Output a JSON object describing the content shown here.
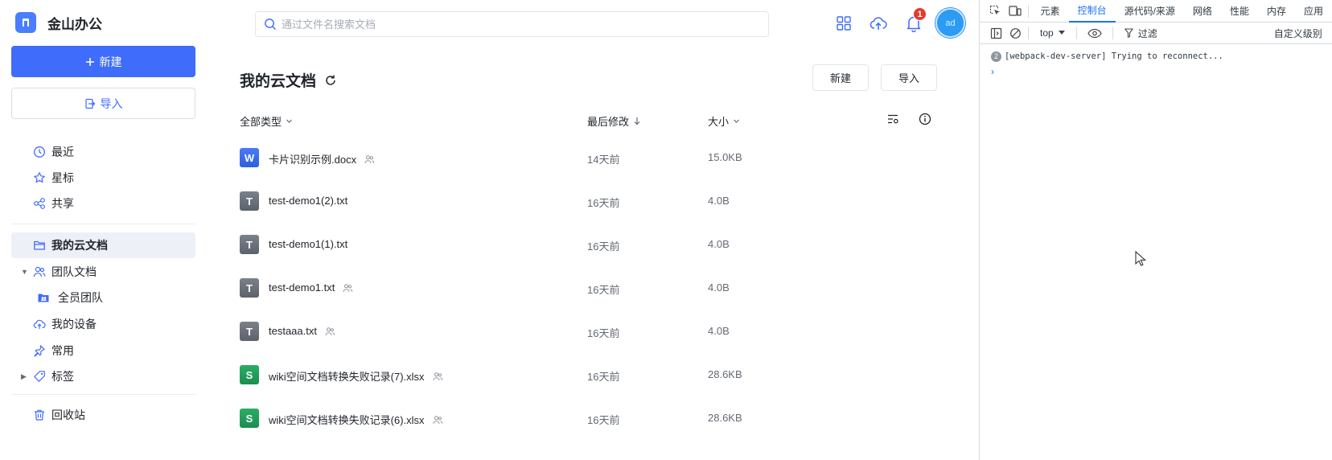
{
  "app": {
    "name": "金山办公",
    "new_button": "新建",
    "import_button": "导入",
    "search_placeholder": "通过文件名搜索文档",
    "notification_count": "1",
    "avatar_text": "ad",
    "accent_color": "#3f6cfa"
  },
  "sidebar": {
    "items": [
      {
        "label": "最近",
        "icon": "clock-icon"
      },
      {
        "label": "星标",
        "icon": "star-icon"
      },
      {
        "label": "共享",
        "icon": "share-icon"
      },
      {
        "label": "我的云文档",
        "icon": "folder-icon",
        "active": true
      },
      {
        "label": "团队文档",
        "icon": "team-icon"
      },
      {
        "label": "全员团队",
        "icon": "team-folder-icon"
      },
      {
        "label": "我的设备",
        "icon": "cloud-device-icon"
      },
      {
        "label": "常用",
        "icon": "pin-icon"
      },
      {
        "label": "标签",
        "icon": "tag-icon"
      },
      {
        "label": "回收站",
        "icon": "trash-icon"
      }
    ]
  },
  "main": {
    "title": "我的云文档",
    "new_button": "新建",
    "import_button": "导入",
    "columns": {
      "type": "全部类型",
      "modified": "最后修改",
      "size": "大小"
    },
    "files": [
      {
        "name": "卡片识别示例.docx",
        "type": "word",
        "type_letter": "W",
        "modified": "14天前",
        "size": "15.0KB",
        "shared": true
      },
      {
        "name": "test-demo1(2).txt",
        "type": "text",
        "type_letter": "T",
        "modified": "16天前",
        "size": "4.0B",
        "shared": false
      },
      {
        "name": "test-demo1(1).txt",
        "type": "text",
        "type_letter": "T",
        "modified": "16天前",
        "size": "4.0B",
        "shared": false
      },
      {
        "name": "test-demo1.txt",
        "type": "text",
        "type_letter": "T",
        "modified": "16天前",
        "size": "4.0B",
        "shared": true
      },
      {
        "name": "testaaa.txt",
        "type": "text",
        "type_letter": "T",
        "modified": "16天前",
        "size": "4.0B",
        "shared": true
      },
      {
        "name": "wiki空间文档转换失败记录(7).xlsx",
        "type": "sheet",
        "type_letter": "S",
        "modified": "16天前",
        "size": "28.6KB",
        "shared": true
      },
      {
        "name": "wiki空间文档转换失败记录(6).xlsx",
        "type": "sheet",
        "type_letter": "S",
        "modified": "16天前",
        "size": "28.6KB",
        "shared": true
      }
    ]
  },
  "devtools": {
    "tabs": [
      "元素",
      "控制台",
      "源代码/来源",
      "网络",
      "性能",
      "内存",
      "应用"
    ],
    "active_tab": "控制台",
    "context": "top",
    "filter_label": "过滤",
    "levels_label": "自定义级别",
    "messages": [
      {
        "count": "2",
        "text": "[webpack-dev-server] Trying to reconnect..."
      }
    ],
    "prompt": "›"
  }
}
